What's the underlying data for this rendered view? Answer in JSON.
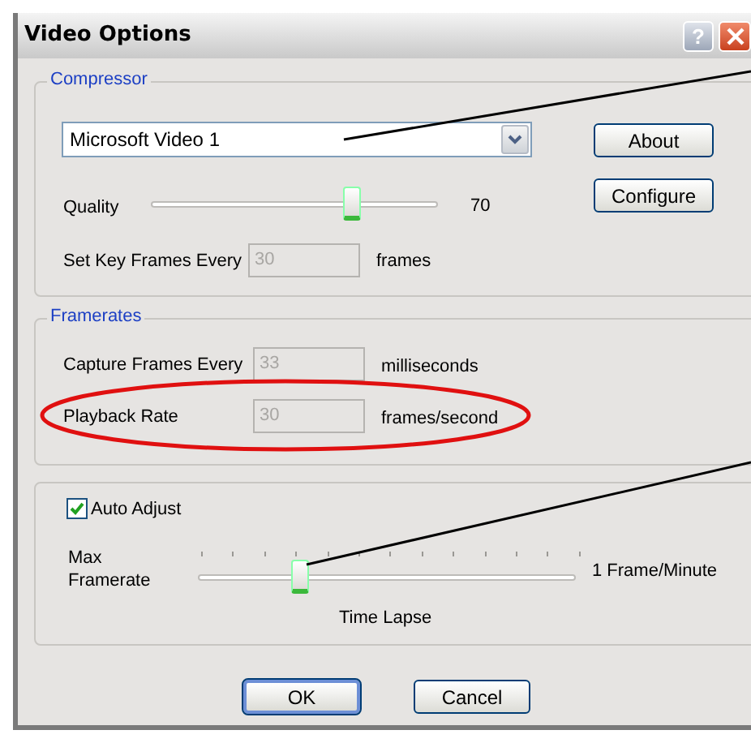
{
  "window": {
    "title": "Video Options",
    "help": "?"
  },
  "compressor": {
    "legend": "Compressor",
    "codec": "Microsoft Video 1",
    "quality": {
      "label": "Quality",
      "level": 0.7,
      "reading": "70"
    },
    "key_frames": {
      "label": "Set Key Frames Every",
      "value": "30",
      "unit": "frames",
      "disabled": true
    },
    "buttons": [
      "About",
      "Configure"
    ]
  },
  "framerates": {
    "legend": "Framerates",
    "rows": [
      {
        "label": "Capture Frames Every",
        "value": "33",
        "unit": "milliseconds",
        "disabled": true
      },
      {
        "label": "Playback Rate",
        "value": "30",
        "unit": "frames/second",
        "disabled": true
      }
    ]
  },
  "auto": {
    "checkbox": {
      "label": "Auto Adjust",
      "checked": true
    },
    "slider": {
      "label": "Max Framerate",
      "level": 0.27,
      "end_label": "1 Frame/Minute",
      "caption": "Time Lapse"
    }
  },
  "buttons": [
    {
      "label": "OK",
      "default": true
    },
    {
      "label": "Cancel",
      "default": false
    }
  ]
}
